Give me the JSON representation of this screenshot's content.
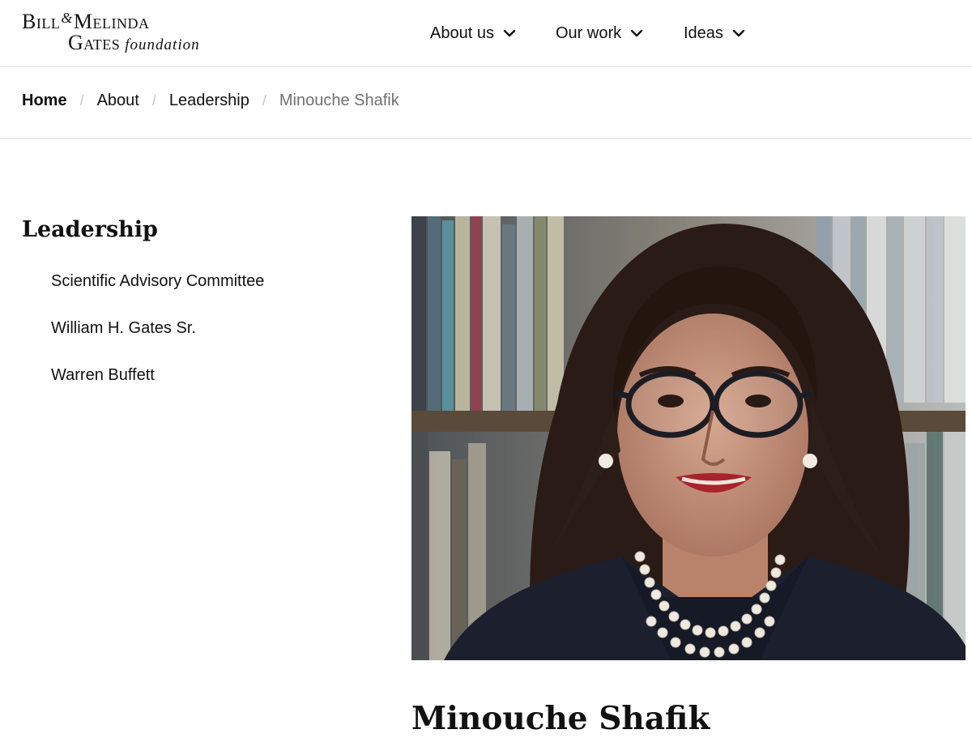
{
  "logo": {
    "line1_a": "Bill",
    "line1_amp": "&",
    "line1_b": "Melinda",
    "line2_a": "Gates",
    "line2_b": "foundation"
  },
  "nav": {
    "about": "About us",
    "work": "Our work",
    "ideas": "Ideas"
  },
  "breadcrumb": {
    "home": "Home",
    "about": "About",
    "leadership": "Leadership",
    "current": "Minouche Shafik",
    "separator": "/"
  },
  "sidebar": {
    "heading": "Leadership",
    "items": [
      {
        "label": "Scientific Advisory Committee"
      },
      {
        "label": "William H. Gates Sr."
      },
      {
        "label": "Warren Buffett"
      }
    ]
  },
  "profile": {
    "name": "Minouche Shafik",
    "photo_subject": "portrait of woman with glasses and pearl necklace in front of bookshelf"
  },
  "icons": {
    "nav_chevron": "chevron-down-icon"
  }
}
